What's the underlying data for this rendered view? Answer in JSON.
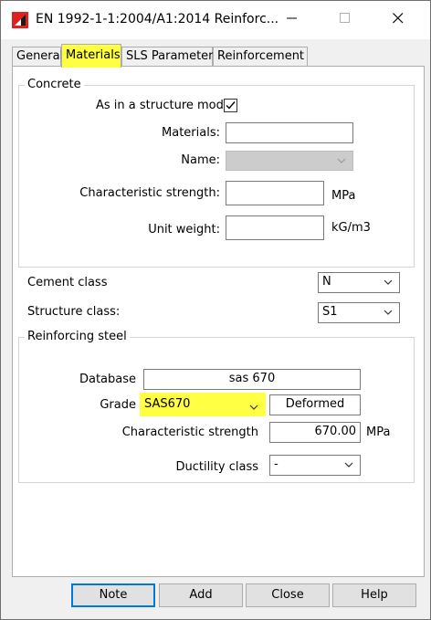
{
  "window": {
    "title": "EN 1992-1-1:2004/A1:2014 Reinforc...",
    "icons": {
      "app": "red-flag-icon",
      "minimize": "minimize-icon",
      "maximize": "maximize-icon",
      "close": "close-icon"
    }
  },
  "tabs": [
    {
      "label": "General"
    },
    {
      "label": "Materials"
    },
    {
      "label": "SLS Parameters"
    },
    {
      "label": "Reinforcement"
    }
  ],
  "concrete": {
    "group_title": "Concrete",
    "structure_model_label": "As in a structure model",
    "structure_model_checked": true,
    "materials_label": "Materials:",
    "materials_value": "",
    "name_label": "Name:",
    "name_value": "",
    "char_strength_label": "Characteristic strength:",
    "char_strength_value": "",
    "char_strength_unit": "MPa",
    "unit_weight_label": "Unit weight:",
    "unit_weight_value": "",
    "unit_weight_unit": "kG/m3"
  },
  "cement_class": {
    "label": "Cement class",
    "value": "N"
  },
  "structure_class": {
    "label": "Structure class:",
    "value": "S1"
  },
  "reinforcing_steel": {
    "group_title": "Reinforcing steel",
    "database_label": "Database",
    "database_value": "sas 670",
    "grade_label": "Grade",
    "grade_value": "SAS670",
    "deformed_label": "Deformed",
    "char_strength_label": "Characteristic strength",
    "char_strength_value": "670.00",
    "char_strength_unit": "MPa",
    "ductility_label": "Ductility class",
    "ductility_value": "-"
  },
  "buttons": {
    "note": "Note",
    "add": "Add",
    "close": "Close",
    "help": "Help"
  },
  "colors": {
    "highlight": "#ffff44",
    "accent": "#0078d7"
  }
}
